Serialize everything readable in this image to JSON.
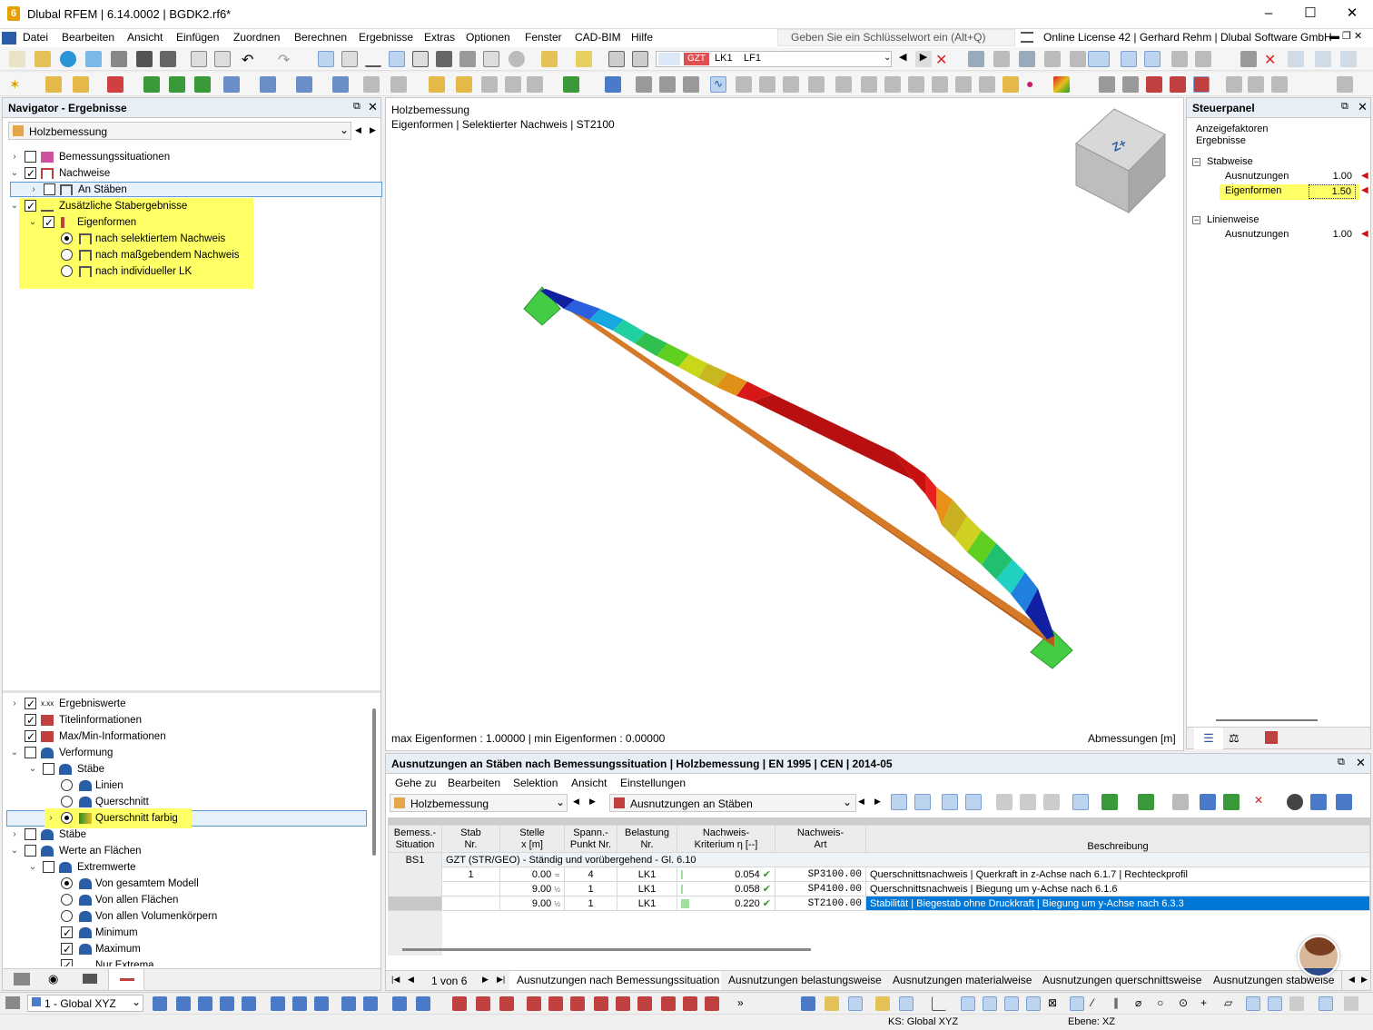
{
  "app": {
    "title": "Dlubal RFEM | 6.14.0002 | BGDK2.rf6*",
    "logo": "6"
  },
  "menu": {
    "items": [
      "Datei",
      "Bearbeiten",
      "Ansicht",
      "Einfügen",
      "Zuordnen",
      "Berechnen",
      "Ergebnisse",
      "Extras",
      "Optionen",
      "Fenster",
      "CAD-BIM",
      "Hilfe"
    ],
    "search_placeholder": "Geben Sie ein Schlüsselwort ein (Alt+Q)",
    "license": "Online License 42 | Gerhard Rehm | Dlubal Software GmbH"
  },
  "toolbar": {
    "combo_badge": "GZT",
    "combo_lk": "LK1",
    "combo_lf": "LF1"
  },
  "navigator": {
    "title": "Navigator - Ergebnisse",
    "dropdown": "Holzbemessung",
    "top_items": [
      "Bemessungssituationen",
      "Nachweise",
      "An Stäben",
      "Zusätzliche Stabergebnisse",
      "Eigenformen",
      "nach selektiertem Nachweis",
      "nach maßgebendem Nachweis",
      "nach individueller LK"
    ],
    "bottom_items": [
      "Ergebniswerte",
      "Titelinformationen",
      "Max/Min-Informationen",
      "Verformung",
      "Stäbe",
      "Linien",
      "Querschnitt",
      "Querschnitt farbig",
      "Stäbe",
      "Werte an Flächen",
      "Extremwerte",
      "Von gesamtem Modell",
      "Von allen Flächen",
      "Von allen Volumenkörpern",
      "Minimum",
      "Maximum",
      "Nur Extrema"
    ]
  },
  "viewport": {
    "title1": "Holzbemessung",
    "title2": "Eigenformen | Selektierter Nachweis | ST2100",
    "info": "max Eigenformen : 1.00000 | min Eigenformen : 0.00000",
    "units": "Abmessungen [m]",
    "cube_label": "Z+"
  },
  "steuerpanel": {
    "title": "Steuerpanel",
    "sub1": "Anzeigefaktoren",
    "sub2": "Ergebnisse",
    "group1": "Stabweise",
    "row1_label": "Ausnutzungen",
    "row1_value": "1.00",
    "row2_label": "Eigenformen",
    "row2_value": "1.50",
    "group2": "Linienweise",
    "row3_label": "Ausnutzungen",
    "row3_value": "1.00"
  },
  "results": {
    "title": "Ausnutzungen an Stäben nach Bemessungssituation | Holzbemessung | EN 1995 | CEN | 2014-05",
    "menu": [
      "Gehe zu",
      "Bearbeiten",
      "Selektion",
      "Ansicht",
      "Einstellungen"
    ],
    "dropdown1": "Holzbemessung",
    "dropdown2": "Ausnutzungen an Stäben",
    "headers": {
      "c1a": "Bemess.-",
      "c1b": "Situation",
      "c2a": "Stab",
      "c2b": "Nr.",
      "c3a": "Stelle",
      "c3b": "x [m]",
      "c4a": "Spann.-",
      "c4b": "Punkt Nr.",
      "c5a": "Belastung",
      "c5b": "Nr.",
      "c6a": "Nachweis-",
      "c6b": "Kriterium η [--]",
      "c7a": "Nachweis-",
      "c7b": "Art",
      "c8": "Beschreibung"
    },
    "situation": "BS1",
    "group_text": "GZT (STR/GEO) - Ständig und vorübergehend - Gl. 6.10",
    "rows": [
      {
        "stab": "1",
        "x": "0.00",
        "punkt": "4",
        "lk": "LK1",
        "eta": "0.054",
        "art": "SP3100.00",
        "desc": "Querschnittsnachweis | Querkraft in z-Achse nach 6.1.7 | Rechteckprofil"
      },
      {
        "stab": "",
        "x": "9.00",
        "punkt": "1",
        "lk": "LK1",
        "eta": "0.058",
        "art": "SP4100.00",
        "desc": "Querschnittsnachweis | Biegung um y-Achse nach 6.1.6"
      },
      {
        "stab": "",
        "x": "9.00",
        "punkt": "1",
        "lk": "LK1",
        "eta": "0.220",
        "art": "ST2100.00",
        "desc": "Stabilität | Biegestab ohne Druckkraft | Biegung um y-Achse nach 6.3.3"
      }
    ],
    "pager": "1 von 6",
    "tabs": [
      "Ausnutzungen nach Bemessungssituation",
      "Ausnutzungen belastungsweise",
      "Ausnutzungen materialweise",
      "Ausnutzungen querschnittsweise",
      "Ausnutzungen stabweise"
    ]
  },
  "status": {
    "coord": "1 - Global XYZ",
    "ks": "KS: Global XYZ",
    "ebene": "Ebene: XZ"
  },
  "colors": {
    "accent": "#0078d7",
    "highlight": "#ffff66",
    "beam": "#c86e1e"
  }
}
